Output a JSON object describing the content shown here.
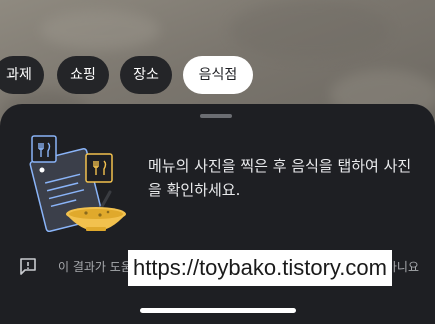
{
  "chips": [
    {
      "label": "과제",
      "active": false
    },
    {
      "label": "쇼핑",
      "active": false
    },
    {
      "label": "장소",
      "active": false
    },
    {
      "label": "음식점",
      "active": true
    }
  ],
  "sheet": {
    "message": "메뉴의 사진을 찍은 후 음식을 탭하여 사진을 확인하세요.",
    "illustration_icon": "menu-and-food-bowl",
    "feedback": {
      "icon": "feedback-icon",
      "text": "이 결과가 도움이 되었나요?",
      "action": "아니요"
    }
  },
  "watermark": "https://toybako.tistory.com",
  "colors": {
    "sheet_bg": "#1e1f23",
    "chip_bg": "#242528",
    "chip_active_bg": "#ffffff",
    "accent_yellow": "#f2c14e",
    "accent_blue": "#8ab4f8"
  }
}
